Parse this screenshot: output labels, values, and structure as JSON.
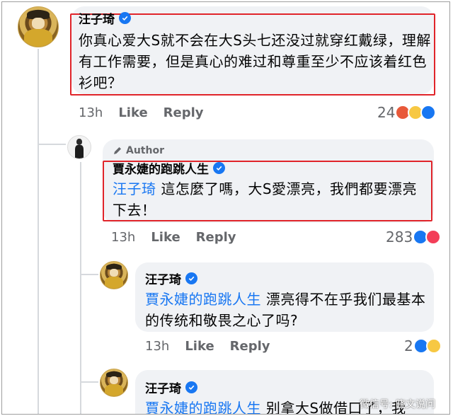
{
  "comments": [
    {
      "author": "汪子琦",
      "text": "你真心爱大S就不会在大S头七还没过就穿红戴绿，理解有工作需要，但是真心的难过和尊重至少不应该着红色衫吧？",
      "time": "13h",
      "like": "Like",
      "reply": "Reply",
      "react_count": "24"
    },
    {
      "badge": "Author",
      "author": "賈永婕的跑跳人生",
      "mention": "汪子琦",
      "text": " 這怎麼了嗎，大S愛漂亮，我們都要漂亮下去！",
      "time": "13h",
      "like": "Like",
      "reply": "Reply",
      "react_count": "283"
    },
    {
      "author": "汪子琦",
      "mention": "賈永婕的跑跳人生",
      "text": " 漂亮得不在乎我们最基本的传统和敬畏之心了吗?",
      "time": "13h",
      "like": "Like",
      "reply": "Reply",
      "react_count": "2"
    },
    {
      "author": "汪子琦",
      "mention": "賈永婕的跑跳人生",
      "text": " 别拿大S做借口了，我"
    }
  ],
  "watermark": "微信号: 晓文说问",
  "colors": {
    "accent": "#1877f2",
    "highlight_box": "#e0242a",
    "bubble": "#f0f2f5",
    "meta_text": "#65676b"
  },
  "icons": [
    "verified-badge-icon",
    "pencil-icon",
    "like-reaction-icon",
    "angry-reaction-icon",
    "haha-reaction-icon",
    "love-reaction-icon",
    "wow-reaction-icon"
  ]
}
